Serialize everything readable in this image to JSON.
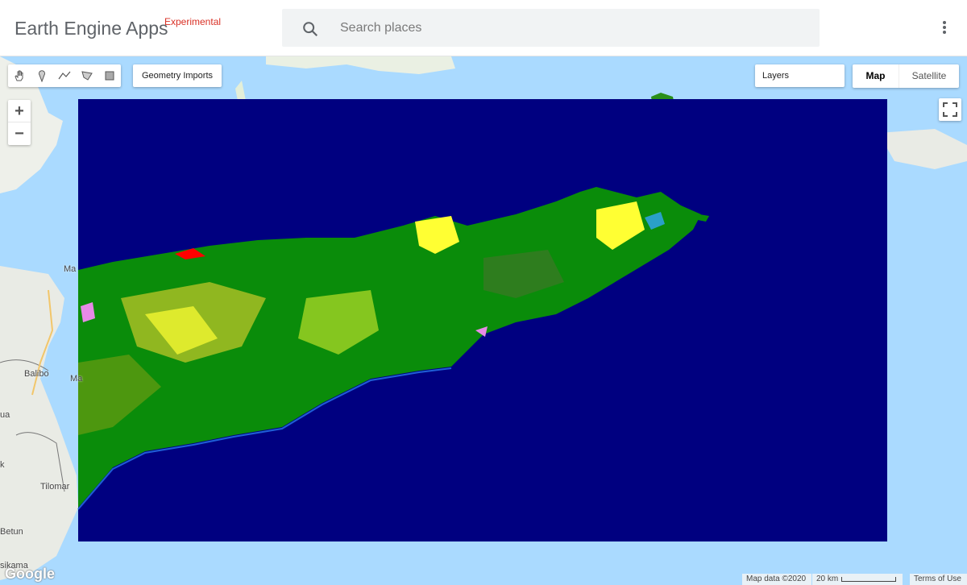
{
  "header": {
    "title": "Earth Engine Apps",
    "badge": "Experimental",
    "search_placeholder": "Search places"
  },
  "toolbar": {
    "tools": [
      "pan-hand-icon",
      "point-marker-icon",
      "line-icon",
      "polygon-icon",
      "rectangle-icon"
    ],
    "geometry_imports_label": "Geometry Imports",
    "layers_label": "Layers",
    "map_tab_label": "Map",
    "satellite_tab_label": "Satellite"
  },
  "zoom": {
    "in": "+",
    "out": "−"
  },
  "place_labels": [
    "Ma",
    "Balibo",
    "Ma",
    "ua",
    "k",
    "Tilomar",
    "Betun",
    "sikama"
  ],
  "attribution": {
    "logo": "Google",
    "map_data": "Map data ©2020",
    "scale": "20 km",
    "terms": "Terms of Use"
  },
  "colors": {
    "ocean_class": "#000080",
    "forest": "#0a8c0a",
    "dense_forest": "#2e7d1e",
    "cropland": "#ffff33",
    "urban": "#ff0000",
    "wetland": "#e78ae7",
    "water_bg": "#aadaff"
  }
}
